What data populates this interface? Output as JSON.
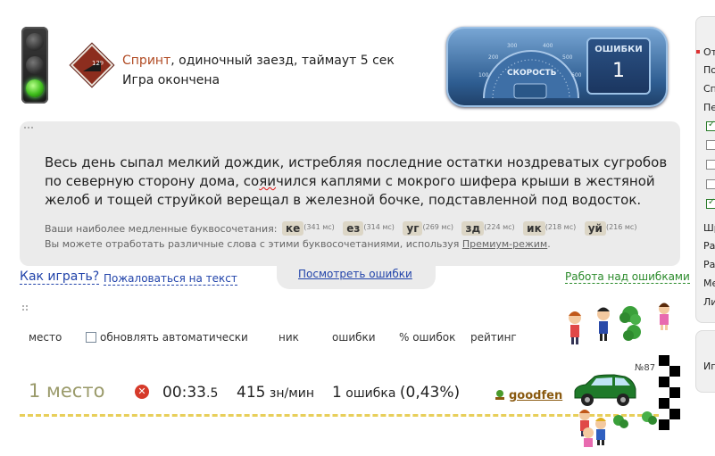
{
  "race": {
    "type": "Спринт",
    "details": ", одиночный заезд, таймаут 5 сек",
    "status": "Игра окончена",
    "slope_label": "12%"
  },
  "dashboard": {
    "speed_label": "СКОРОСТЬ",
    "errors_label": "ОШИБКИ",
    "errors_value": "1",
    "gauge_ticks": [
      "100",
      "200",
      "300",
      "400",
      "500",
      "600"
    ]
  },
  "text": {
    "before_error": "Весь день сыпал мелкий дождик, истребляя последние остатки ноздреватых сугробов по северную сторону дома, со",
    "error": "яи",
    "after_error": "чился каплями с мокрого шифера крыши в жестяной желоб и тощей струйкой верещал в железной бочке, подставленной под водосток."
  },
  "slow_combos": {
    "label": "Ваши наиболее медленные буквосочетания:",
    "items": [
      {
        "combo": "ке",
        "ms": "(341 мс)"
      },
      {
        "combo": "ез",
        "ms": "(314 мс)"
      },
      {
        "combo": "уг",
        "ms": "(269 мс)"
      },
      {
        "combo": "зд",
        "ms": "(224 мс)"
      },
      {
        "combo": "ик",
        "ms": "(218 мс)"
      },
      {
        "combo": "уй",
        "ms": "(216 мс)"
      }
    ],
    "practice_prefix": "Вы можете отработать различные слова с этими буквосочетаниями, используя ",
    "practice_link": "Премиум-режим",
    "practice_suffix": "."
  },
  "links": {
    "view_errors": "Посмотреть ошибки",
    "how_to_play": "Как играть?",
    "complain": "Пожаловаться на текст",
    "work_on_errors": "Работа над ошибками"
  },
  "table": {
    "header": {
      "place": "место",
      "auto_update": "обновлять автоматически",
      "nick": "ник",
      "errors": "ошибки",
      "error_pct": "% ошибок",
      "rating": "рейтинг"
    },
    "result": {
      "place": "1 место",
      "time_main": "00:33",
      "time_frac": ".5",
      "speed_value": "415",
      "speed_unit": " зн/мин",
      "errors_count": "1",
      "errors_word": " ошибка ",
      "errors_pct": "(0,43%)",
      "user": "goodfen",
      "car_number": "№87"
    }
  },
  "sidebar": {
    "lines": [
      "От",
      "По",
      "Сп",
      "Пе",
      "Шр",
      "Ра",
      "Ра",
      "Ме",
      "Ли"
    ],
    "bottom": "Иг"
  },
  "colors": {
    "race_type": "#b14b24",
    "link": "#2244aa",
    "work_link": "#2a8a2a",
    "place_text": "#9a9a6a",
    "track_dash": "#e8cf5a",
    "car": "#1f7a2a"
  }
}
